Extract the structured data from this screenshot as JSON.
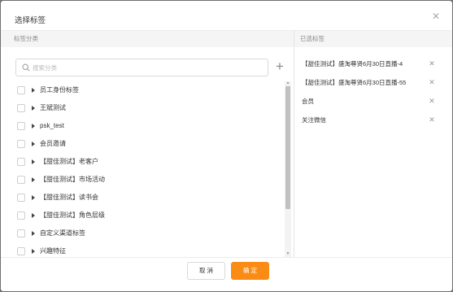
{
  "dialog": {
    "title": "选择标签",
    "close_icon": "close-icon"
  },
  "left_panel": {
    "header": "标签分类",
    "search_placeholder": "搜索分类",
    "add_icon": "plus-icon",
    "items": [
      {
        "label": "员工身份标签"
      },
      {
        "label": "王斌测试"
      },
      {
        "label": "psk_test"
      },
      {
        "label": "会员邀请"
      },
      {
        "label": "【甜佳测试】老客户"
      },
      {
        "label": "【甜佳测试】市场活动"
      },
      {
        "label": "【甜佳测试】读书会"
      },
      {
        "label": "【甜佳测试】角色层级"
      },
      {
        "label": "自定义渠道标签"
      },
      {
        "label": "兴趣特征"
      }
    ]
  },
  "right_panel": {
    "header": "已选标签",
    "items": [
      {
        "label": "【甜佳测试】盛淘尊贤6月30日直播-4"
      },
      {
        "label": "【甜佳测试】盛淘尊贤6月30日直播-55"
      },
      {
        "label": "会员"
      },
      {
        "label": "关注微信"
      }
    ]
  },
  "footer": {
    "cancel_label": "取 消",
    "ok_label": "确 定"
  },
  "colors": {
    "accent": "#fa8c16",
    "overlay": "#6f6f6f"
  }
}
